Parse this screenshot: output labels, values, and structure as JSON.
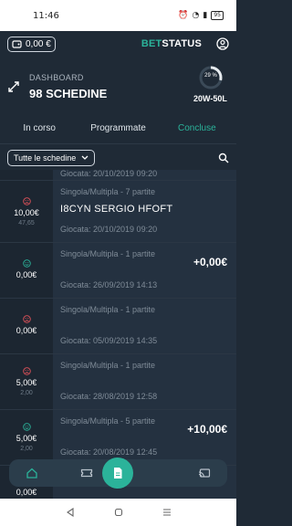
{
  "status": {
    "time": "11:46",
    "battery": "95"
  },
  "topbar": {
    "balance": "0,00 €",
    "brand_bet": "BET",
    "brand_status": "STATUS"
  },
  "dashboard": {
    "label": "DASHBOARD",
    "count": "98 SCHEDINE",
    "percent": "29 %",
    "percent_value": 29,
    "record": "20W-50L"
  },
  "tabs": [
    {
      "label": "In corso",
      "active": false
    },
    {
      "label": "Programmate",
      "active": false
    },
    {
      "label": "Concluse",
      "active": true
    }
  ],
  "filter": {
    "selected": "Tutte le schedine"
  },
  "bets": [
    {
      "stake": "",
      "odds": "",
      "type": "",
      "teams": "",
      "date": "Giocata: 20/10/2019 09:20",
      "win": "",
      "outcome": ""
    },
    {
      "stake": "10,00€",
      "odds": "47,65",
      "type": "Singola/Multipla - 7 partite",
      "teams": "I8CYN  SERGIO HFOFT",
      "date": "Giocata: 20/10/2019 09:20",
      "win": "",
      "outcome": "lost"
    },
    {
      "stake": "0,00€",
      "odds": "",
      "type": "Singola/Multipla - 1 partite",
      "teams": "",
      "date": "Giocata: 26/09/2019 14:13",
      "win": "+0,00€",
      "outcome": "won"
    },
    {
      "stake": "0,00€",
      "odds": "",
      "type": "Singola/Multipla - 1 partite",
      "teams": "",
      "date": "Giocata: 05/09/2019 14:35",
      "win": "",
      "outcome": "lost"
    },
    {
      "stake": "5,00€",
      "odds": "2,00",
      "type": "Singola/Multipla - 1 partite",
      "teams": "",
      "date": "Giocata: 28/08/2019 12:58",
      "win": "",
      "outcome": "lost"
    },
    {
      "stake": "5,00€",
      "odds": "2,00",
      "type": "Singola/Multipla - 5 partite",
      "teams": "",
      "date": "Giocata: 20/08/2019 12:45",
      "win": "+10,00€",
      "outcome": "won"
    },
    {
      "stake": "0,00€",
      "odds": "",
      "type": "",
      "teams": "",
      "date": "",
      "win": "",
      "outcome": ""
    }
  ],
  "colors": {
    "accent": "#2bb39a",
    "won": "#2bb39a",
    "lost": "#e0525a",
    "background": "#1f2a36"
  },
  "icons": {
    "home": "home-icon",
    "ticket": "ticket-icon",
    "document": "document-icon",
    "cast": "cast-icon"
  }
}
